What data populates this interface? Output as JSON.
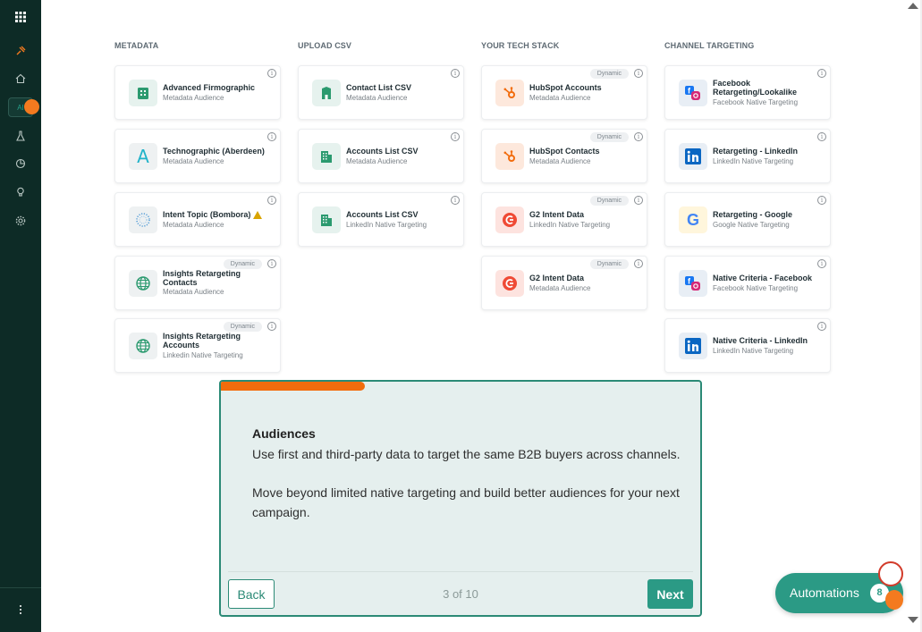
{
  "sidebar": {
    "items": [
      {
        "name": "grid-icon"
      },
      {
        "name": "pin-icon"
      },
      {
        "name": "home-icon"
      },
      {
        "name": "ai-item",
        "label": "AI"
      },
      {
        "name": "flask-icon"
      },
      {
        "name": "pie-chart-icon"
      },
      {
        "name": "lightbulb-icon"
      },
      {
        "name": "settings-icon"
      },
      {
        "name": "more-icon"
      }
    ]
  },
  "columns": {
    "metadata": {
      "header": "METADATA",
      "cards": [
        {
          "title": "Advanced Firmographic",
          "subtitle": "Metadata Audience",
          "icon": "building-icon"
        },
        {
          "title": "Technographic (Aberdeen)",
          "subtitle": "Metadata Audience",
          "icon": "letter-a-icon"
        },
        {
          "title": "Intent Topic (Bombora)",
          "subtitle": "Metadata Audience",
          "icon": "bombora-icon",
          "warning": true
        },
        {
          "title": "Insights Retargeting Contacts",
          "subtitle": "Metadata Audience",
          "icon": "globe-icon",
          "badge": "Dynamic"
        },
        {
          "title": "Insights Retargeting Accounts",
          "subtitle": "Linkedin Native Targeting",
          "icon": "globe-icon",
          "badge": "Dynamic"
        }
      ]
    },
    "upload_csv": {
      "header": "UPLOAD CSV",
      "cards": [
        {
          "title": "Contact List CSV",
          "subtitle": "Metadata Audience",
          "icon": "building-icon"
        },
        {
          "title": "Accounts List CSV",
          "subtitle": "Metadata Audience",
          "icon": "office-icon"
        },
        {
          "title": "Accounts List CSV",
          "subtitle": "LinkedIn Native Targeting",
          "icon": "office-icon"
        }
      ]
    },
    "tech_stack": {
      "header": "YOUR TECH STACK",
      "cards": [
        {
          "title": "HubSpot Accounts",
          "subtitle": "Metadata Audience",
          "icon": "hubspot-icon",
          "badge": "Dynamic"
        },
        {
          "title": "HubSpot Contacts",
          "subtitle": "Metadata Audience",
          "icon": "hubspot-icon",
          "badge": "Dynamic"
        },
        {
          "title": "G2 Intent Data",
          "subtitle": "LinkedIn Native Targeting",
          "icon": "g2-icon",
          "badge": "Dynamic"
        },
        {
          "title": "G2 Intent Data",
          "subtitle": "Metadata Audience",
          "icon": "g2-icon",
          "badge": "Dynamic"
        }
      ]
    },
    "channel_targeting": {
      "header": "CHANNEL TARGETING",
      "cards": [
        {
          "title": "Facebook Retargeting/Lookalike",
          "subtitle": "Facebook Native Targeting",
          "icon": "facebook-instagram-icon"
        },
        {
          "title": "Retargeting - LinkedIn",
          "subtitle": "LinkedIn Native Targeting",
          "icon": "linkedin-icon"
        },
        {
          "title": "Retargeting - Google",
          "subtitle": "Google Native Targeting",
          "icon": "google-icon"
        },
        {
          "title": "Native Criteria - Facebook",
          "subtitle": "Facebook Native Targeting",
          "icon": "facebook-instagram-icon"
        },
        {
          "title": "Native Criteria - LinkedIn",
          "subtitle": "LinkedIn Native Targeting",
          "icon": "linkedin-icon"
        }
      ]
    }
  },
  "tour": {
    "progress": 0.3,
    "title": "Audiences",
    "paragraph1": "Use first and third-party data to target the same B2B buyers across channels.",
    "paragraph2": "Move beyond limited native targeting and build better audiences for your next campaign.",
    "back_label": "Back",
    "step": "3 of 10",
    "next_label": "Next"
  },
  "automations": {
    "label": "Automations",
    "count": "8"
  },
  "colors": {
    "sidebar": "#0d2b26",
    "accent": "#2b9a85",
    "progress": "#f26c0d"
  }
}
